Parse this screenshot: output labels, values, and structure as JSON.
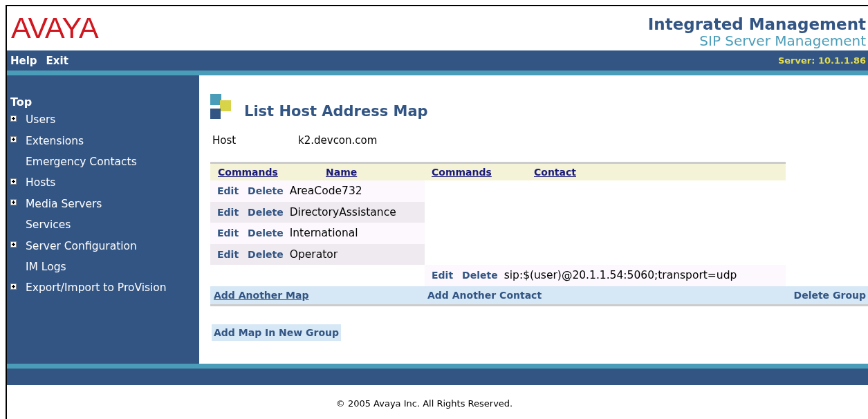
{
  "header": {
    "logo": "AVAYA",
    "title": "Integrated Management",
    "subtitle": "SIP Server Management"
  },
  "nav": {
    "links": [
      "Help",
      "Exit"
    ],
    "server": "Server: 10.1.1.86"
  },
  "sidebar": {
    "heading": "Top",
    "items": [
      {
        "label": "Users",
        "expandable": true
      },
      {
        "label": "Extensions",
        "expandable": true
      },
      {
        "label": "Emergency Contacts",
        "expandable": false
      },
      {
        "label": "Hosts",
        "expandable": true
      },
      {
        "label": "Media Servers",
        "expandable": true
      },
      {
        "label": "Services",
        "expandable": false
      },
      {
        "label": "Server Configuration",
        "expandable": true
      },
      {
        "label": "IM Logs",
        "expandable": false
      },
      {
        "label": "Export/Import to ProVision",
        "expandable": true
      }
    ]
  },
  "page_title": "List Host Address Map",
  "host": {
    "label": "Host",
    "value": "k2.devcon.com"
  },
  "table": {
    "columns": [
      "Commands",
      "Name",
      "Commands",
      "Contact"
    ],
    "maps": [
      {
        "commands": [
          "Edit",
          "Delete"
        ],
        "name": "AreaCode732"
      },
      {
        "commands": [
          "Edit",
          "Delete"
        ],
        "name": "DirectoryAssistance"
      },
      {
        "commands": [
          "Edit",
          "Delete"
        ],
        "name": "International"
      },
      {
        "commands": [
          "Edit",
          "Delete"
        ],
        "name": "Operator"
      }
    ],
    "contacts": [
      {
        "commands": [
          "Edit",
          "Delete"
        ],
        "contact": "sip:$(user)@20.1.1.54:5060;transport=udp"
      }
    ],
    "actions": {
      "add_map": "Add Another Map",
      "add_contact": "Add Another Contact",
      "delete_group": "Delete Group"
    }
  },
  "new_group_button": "Add Map In New Group",
  "footer": {
    "copyright": "© 2005 Avaya Inc. All Rights Reserved."
  }
}
